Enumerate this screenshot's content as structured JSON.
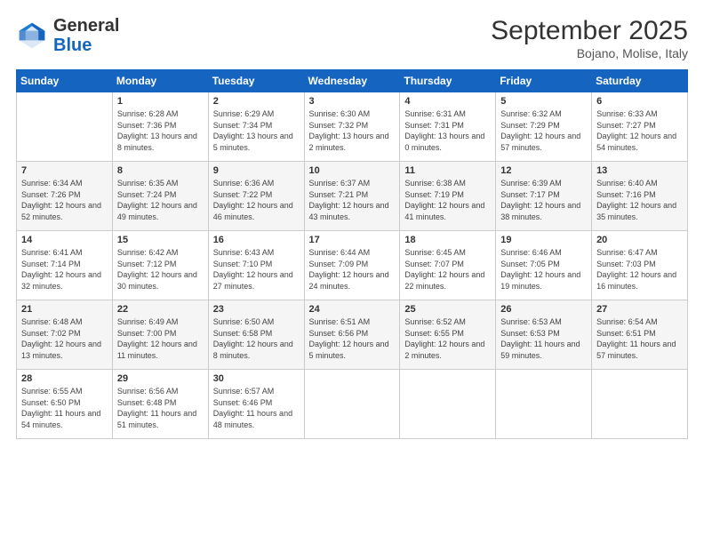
{
  "logo": {
    "general": "General",
    "blue": "Blue"
  },
  "header": {
    "month": "September 2025",
    "location": "Bojano, Molise, Italy"
  },
  "weekdays": [
    "Sunday",
    "Monday",
    "Tuesday",
    "Wednesday",
    "Thursday",
    "Friday",
    "Saturday"
  ],
  "weeks": [
    [
      {
        "day": "",
        "sunrise": "",
        "sunset": "",
        "daylight": ""
      },
      {
        "day": "1",
        "sunrise": "Sunrise: 6:28 AM",
        "sunset": "Sunset: 7:36 PM",
        "daylight": "Daylight: 13 hours and 8 minutes."
      },
      {
        "day": "2",
        "sunrise": "Sunrise: 6:29 AM",
        "sunset": "Sunset: 7:34 PM",
        "daylight": "Daylight: 13 hours and 5 minutes."
      },
      {
        "day": "3",
        "sunrise": "Sunrise: 6:30 AM",
        "sunset": "Sunset: 7:32 PM",
        "daylight": "Daylight: 13 hours and 2 minutes."
      },
      {
        "day": "4",
        "sunrise": "Sunrise: 6:31 AM",
        "sunset": "Sunset: 7:31 PM",
        "daylight": "Daylight: 13 hours and 0 minutes."
      },
      {
        "day": "5",
        "sunrise": "Sunrise: 6:32 AM",
        "sunset": "Sunset: 7:29 PM",
        "daylight": "Daylight: 12 hours and 57 minutes."
      },
      {
        "day": "6",
        "sunrise": "Sunrise: 6:33 AM",
        "sunset": "Sunset: 7:27 PM",
        "daylight": "Daylight: 12 hours and 54 minutes."
      }
    ],
    [
      {
        "day": "7",
        "sunrise": "Sunrise: 6:34 AM",
        "sunset": "Sunset: 7:26 PM",
        "daylight": "Daylight: 12 hours and 52 minutes."
      },
      {
        "day": "8",
        "sunrise": "Sunrise: 6:35 AM",
        "sunset": "Sunset: 7:24 PM",
        "daylight": "Daylight: 12 hours and 49 minutes."
      },
      {
        "day": "9",
        "sunrise": "Sunrise: 6:36 AM",
        "sunset": "Sunset: 7:22 PM",
        "daylight": "Daylight: 12 hours and 46 minutes."
      },
      {
        "day": "10",
        "sunrise": "Sunrise: 6:37 AM",
        "sunset": "Sunset: 7:21 PM",
        "daylight": "Daylight: 12 hours and 43 minutes."
      },
      {
        "day": "11",
        "sunrise": "Sunrise: 6:38 AM",
        "sunset": "Sunset: 7:19 PM",
        "daylight": "Daylight: 12 hours and 41 minutes."
      },
      {
        "day": "12",
        "sunrise": "Sunrise: 6:39 AM",
        "sunset": "Sunset: 7:17 PM",
        "daylight": "Daylight: 12 hours and 38 minutes."
      },
      {
        "day": "13",
        "sunrise": "Sunrise: 6:40 AM",
        "sunset": "Sunset: 7:16 PM",
        "daylight": "Daylight: 12 hours and 35 minutes."
      }
    ],
    [
      {
        "day": "14",
        "sunrise": "Sunrise: 6:41 AM",
        "sunset": "Sunset: 7:14 PM",
        "daylight": "Daylight: 12 hours and 32 minutes."
      },
      {
        "day": "15",
        "sunrise": "Sunrise: 6:42 AM",
        "sunset": "Sunset: 7:12 PM",
        "daylight": "Daylight: 12 hours and 30 minutes."
      },
      {
        "day": "16",
        "sunrise": "Sunrise: 6:43 AM",
        "sunset": "Sunset: 7:10 PM",
        "daylight": "Daylight: 12 hours and 27 minutes."
      },
      {
        "day": "17",
        "sunrise": "Sunrise: 6:44 AM",
        "sunset": "Sunset: 7:09 PM",
        "daylight": "Daylight: 12 hours and 24 minutes."
      },
      {
        "day": "18",
        "sunrise": "Sunrise: 6:45 AM",
        "sunset": "Sunset: 7:07 PM",
        "daylight": "Daylight: 12 hours and 22 minutes."
      },
      {
        "day": "19",
        "sunrise": "Sunrise: 6:46 AM",
        "sunset": "Sunset: 7:05 PM",
        "daylight": "Daylight: 12 hours and 19 minutes."
      },
      {
        "day": "20",
        "sunrise": "Sunrise: 6:47 AM",
        "sunset": "Sunset: 7:03 PM",
        "daylight": "Daylight: 12 hours and 16 minutes."
      }
    ],
    [
      {
        "day": "21",
        "sunrise": "Sunrise: 6:48 AM",
        "sunset": "Sunset: 7:02 PM",
        "daylight": "Daylight: 12 hours and 13 minutes."
      },
      {
        "day": "22",
        "sunrise": "Sunrise: 6:49 AM",
        "sunset": "Sunset: 7:00 PM",
        "daylight": "Daylight: 12 hours and 11 minutes."
      },
      {
        "day": "23",
        "sunrise": "Sunrise: 6:50 AM",
        "sunset": "Sunset: 6:58 PM",
        "daylight": "Daylight: 12 hours and 8 minutes."
      },
      {
        "day": "24",
        "sunrise": "Sunrise: 6:51 AM",
        "sunset": "Sunset: 6:56 PM",
        "daylight": "Daylight: 12 hours and 5 minutes."
      },
      {
        "day": "25",
        "sunrise": "Sunrise: 6:52 AM",
        "sunset": "Sunset: 6:55 PM",
        "daylight": "Daylight: 12 hours and 2 minutes."
      },
      {
        "day": "26",
        "sunrise": "Sunrise: 6:53 AM",
        "sunset": "Sunset: 6:53 PM",
        "daylight": "Daylight: 11 hours and 59 minutes."
      },
      {
        "day": "27",
        "sunrise": "Sunrise: 6:54 AM",
        "sunset": "Sunset: 6:51 PM",
        "daylight": "Daylight: 11 hours and 57 minutes."
      }
    ],
    [
      {
        "day": "28",
        "sunrise": "Sunrise: 6:55 AM",
        "sunset": "Sunset: 6:50 PM",
        "daylight": "Daylight: 11 hours and 54 minutes."
      },
      {
        "day": "29",
        "sunrise": "Sunrise: 6:56 AM",
        "sunset": "Sunset: 6:48 PM",
        "daylight": "Daylight: 11 hours and 51 minutes."
      },
      {
        "day": "30",
        "sunrise": "Sunrise: 6:57 AM",
        "sunset": "Sunset: 6:46 PM",
        "daylight": "Daylight: 11 hours and 48 minutes."
      },
      {
        "day": "",
        "sunrise": "",
        "sunset": "",
        "daylight": ""
      },
      {
        "day": "",
        "sunrise": "",
        "sunset": "",
        "daylight": ""
      },
      {
        "day": "",
        "sunrise": "",
        "sunset": "",
        "daylight": ""
      },
      {
        "day": "",
        "sunrise": "",
        "sunset": "",
        "daylight": ""
      }
    ]
  ]
}
